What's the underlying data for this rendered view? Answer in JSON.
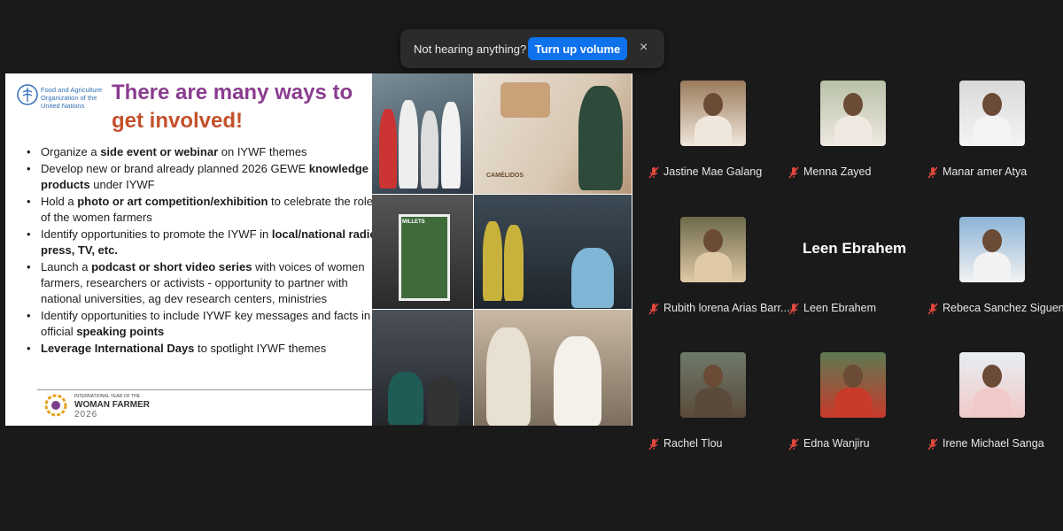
{
  "notification": {
    "message": "Not hearing anything?",
    "action_label": "Turn up volume",
    "close_glyph": "×"
  },
  "slide": {
    "org_name": "Food and Agriculture Organization of the United Nations",
    "title_line1": "There are many ways to",
    "title_line2": "get involved!",
    "bullets": [
      [
        "Organize a ",
        "side event or webinar",
        " on IYWF themes"
      ],
      [
        "Develop new or brand already planned 2026 GEWE ",
        "knowledge products",
        " under IYWF"
      ],
      [
        "Hold a ",
        "photo or art competition/exhibition",
        " to celebrate the roles of the women farmers"
      ],
      [
        "Identify opportunities to promote the IYWF in ",
        "local/national radio, press, TV, etc.",
        ""
      ],
      [
        "Launch a ",
        "podcast or short video series",
        " with voices of women farmers, researchers or activists  - opportunity to partner with national universities, ag dev research centers, ministries"
      ],
      [
        "Identify opportunities to include IYWF key messages and facts in official ",
        "speaking points",
        ""
      ],
      [
        "",
        "Leverage International Days",
        " to spotlight IYWF themes"
      ]
    ],
    "footer_small": "INTERNATIONAL YEAR OF THE",
    "footer_big": "WOMAN FARMER",
    "footer_year": "2026",
    "poster_text": "MILLETS",
    "camelids_text": "CAMÉLIDOS"
  },
  "participants": [
    {
      "name": "Jastine Mae Galang",
      "muted": true
    },
    {
      "name": "Menna Zayed",
      "muted": true
    },
    {
      "name": "Manar amer Atya",
      "muted": true
    },
    {
      "name": "Rubith lorena Arias Barr...",
      "muted": true
    },
    {
      "name": "Leen Ebrahem",
      "muted": true,
      "no_video": true
    },
    {
      "name": "Rebeca Sanchez Siguen...",
      "muted": true
    },
    {
      "name": "Rachel Tlou",
      "muted": true
    },
    {
      "name": "Edna Wanjiru",
      "muted": true
    },
    {
      "name": "Irene Michael Sanga",
      "muted": true
    }
  ],
  "colors": {
    "accent_blue": "#0e72ed",
    "muted_red": "#e0483d",
    "title_purple": "#8a3d8f",
    "title_orange": "#c4512b"
  }
}
